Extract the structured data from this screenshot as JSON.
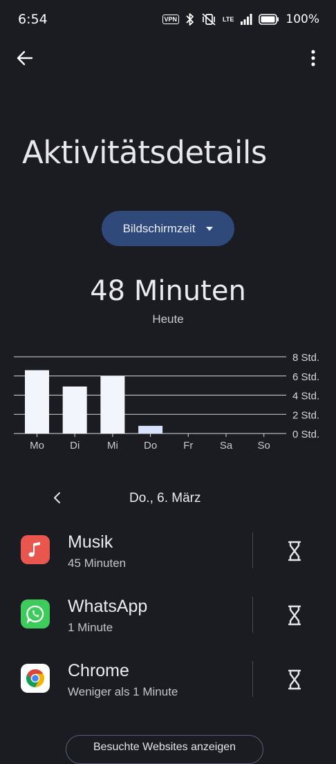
{
  "status_bar": {
    "time": "6:54",
    "vpn": "VPN",
    "lte": "LTE",
    "battery": "100%"
  },
  "header": {
    "title": "Aktivitätsdetails"
  },
  "selector": {
    "label": "Bildschirmzeit"
  },
  "summary": {
    "total": "48 Minuten",
    "period": "Heute"
  },
  "chart_data": {
    "type": "bar",
    "categories": [
      "Mo",
      "Di",
      "Mi",
      "Do",
      "Fr",
      "Sa",
      "So"
    ],
    "values": [
      6.6,
      4.9,
      6.0,
      0.8,
      0,
      0,
      0
    ],
    "ylim": [
      0,
      8
    ],
    "yticks": [
      0,
      2,
      4,
      6,
      8
    ],
    "ytick_labels": [
      "0 Std.",
      "2 Std.",
      "4 Std.",
      "6 Std.",
      "8 Std."
    ],
    "highlight_index": 3,
    "bar_color": "#f3f5fd",
    "highlight_color": "#d8e2fb",
    "grid": true
  },
  "date_nav": {
    "date": "Do., 6. März"
  },
  "apps": [
    {
      "name": "Musik",
      "usage": "45 Minuten",
      "icon": "music-note-icon",
      "color": "#e8564e"
    },
    {
      "name": "WhatsApp",
      "usage": "1 Minute",
      "icon": "whatsapp-icon",
      "color": "#3dcb5b"
    },
    {
      "name": "Chrome",
      "usage": "Weniger als 1 Minute",
      "icon": "chrome-icon",
      "color": "#ffffff"
    }
  ],
  "footer": {
    "button_label": "Besuchte Websites anzeigen"
  }
}
